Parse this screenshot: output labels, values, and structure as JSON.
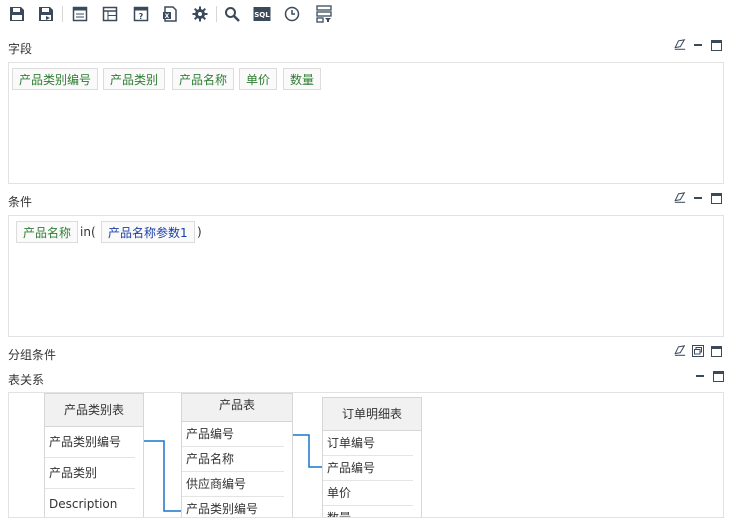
{
  "toolbar": {
    "buttons": [
      {
        "icon": "save-icon"
      },
      {
        "icon": "save-as-icon"
      },
      {
        "icon": "table-icon"
      },
      {
        "icon": "table-layout-icon"
      },
      {
        "icon": "query-param-icon"
      },
      {
        "icon": "export-excel-icon"
      },
      {
        "icon": "gear-icon"
      },
      {
        "icon": "search-icon"
      },
      {
        "icon": "sql-icon",
        "label": "SQL"
      },
      {
        "icon": "clock-icon"
      },
      {
        "icon": "filter-settings-icon"
      }
    ]
  },
  "fields_section": {
    "title": "字段",
    "chips": [
      "产品类别编号",
      "产品类别",
      "产品名称",
      "单价",
      "数量"
    ]
  },
  "conditions_section": {
    "title": "条件",
    "field": "产品名称",
    "operator": "in(",
    "param": "产品名称参数1",
    "close": ")"
  },
  "group_section": {
    "title": "分组条件"
  },
  "relation_section": {
    "title": "表关系",
    "tables": [
      {
        "name": "产品类别表",
        "columns": [
          "产品类别编号",
          "产品类别",
          "Description"
        ]
      },
      {
        "name": "产品表",
        "columns": [
          "产品编号",
          "产品名称",
          "供应商编号",
          "产品类别编号"
        ]
      },
      {
        "name": "订单明细表",
        "columns": [
          "订单编号",
          "产品编号",
          "单价",
          "数量"
        ]
      }
    ]
  },
  "colors": {
    "accent": "#1a76c8",
    "chip_text": "#2e7d32",
    "param_text": "#1a3ea8"
  }
}
